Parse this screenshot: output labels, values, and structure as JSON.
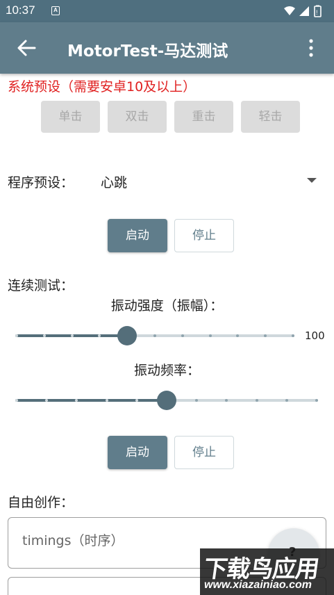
{
  "status_bar": {
    "time": "10:37",
    "app_indicator": "A"
  },
  "app_bar": {
    "title": "MotorTest-马达测试",
    "back_icon": "arrow-left-icon",
    "more_icon": "more-vert-icon"
  },
  "system_presets": {
    "title": "系统预设（需要安卓10及以上）",
    "buttons": [
      "单击",
      "双击",
      "重击",
      "轻击"
    ]
  },
  "program_presets": {
    "label": "程序预设：",
    "selected": "心跳"
  },
  "program_controls": {
    "start": "启动",
    "stop": "停止"
  },
  "continuous_test": {
    "label": "连续测试：",
    "amplitude": {
      "label": "振动强度（振幅）：",
      "value": 100,
      "progress": 0.4,
      "ticks": 11
    },
    "frequency": {
      "label": "振动频率：",
      "progress": 0.5,
      "ticks": 11
    },
    "start": "启动",
    "stop": "停止"
  },
  "free_creation": {
    "label": "自由创作：",
    "timings_placeholder": "timings（时序）",
    "fab_label": "?"
  },
  "watermark": {
    "title": "下载鸟应用",
    "url": "www.xiazainiao.com"
  },
  "colors": {
    "primary": "#607d8b",
    "status_bar": "#4f6f7f",
    "accent_red": "#e02020",
    "disabled_button": "#dcdcdc"
  }
}
